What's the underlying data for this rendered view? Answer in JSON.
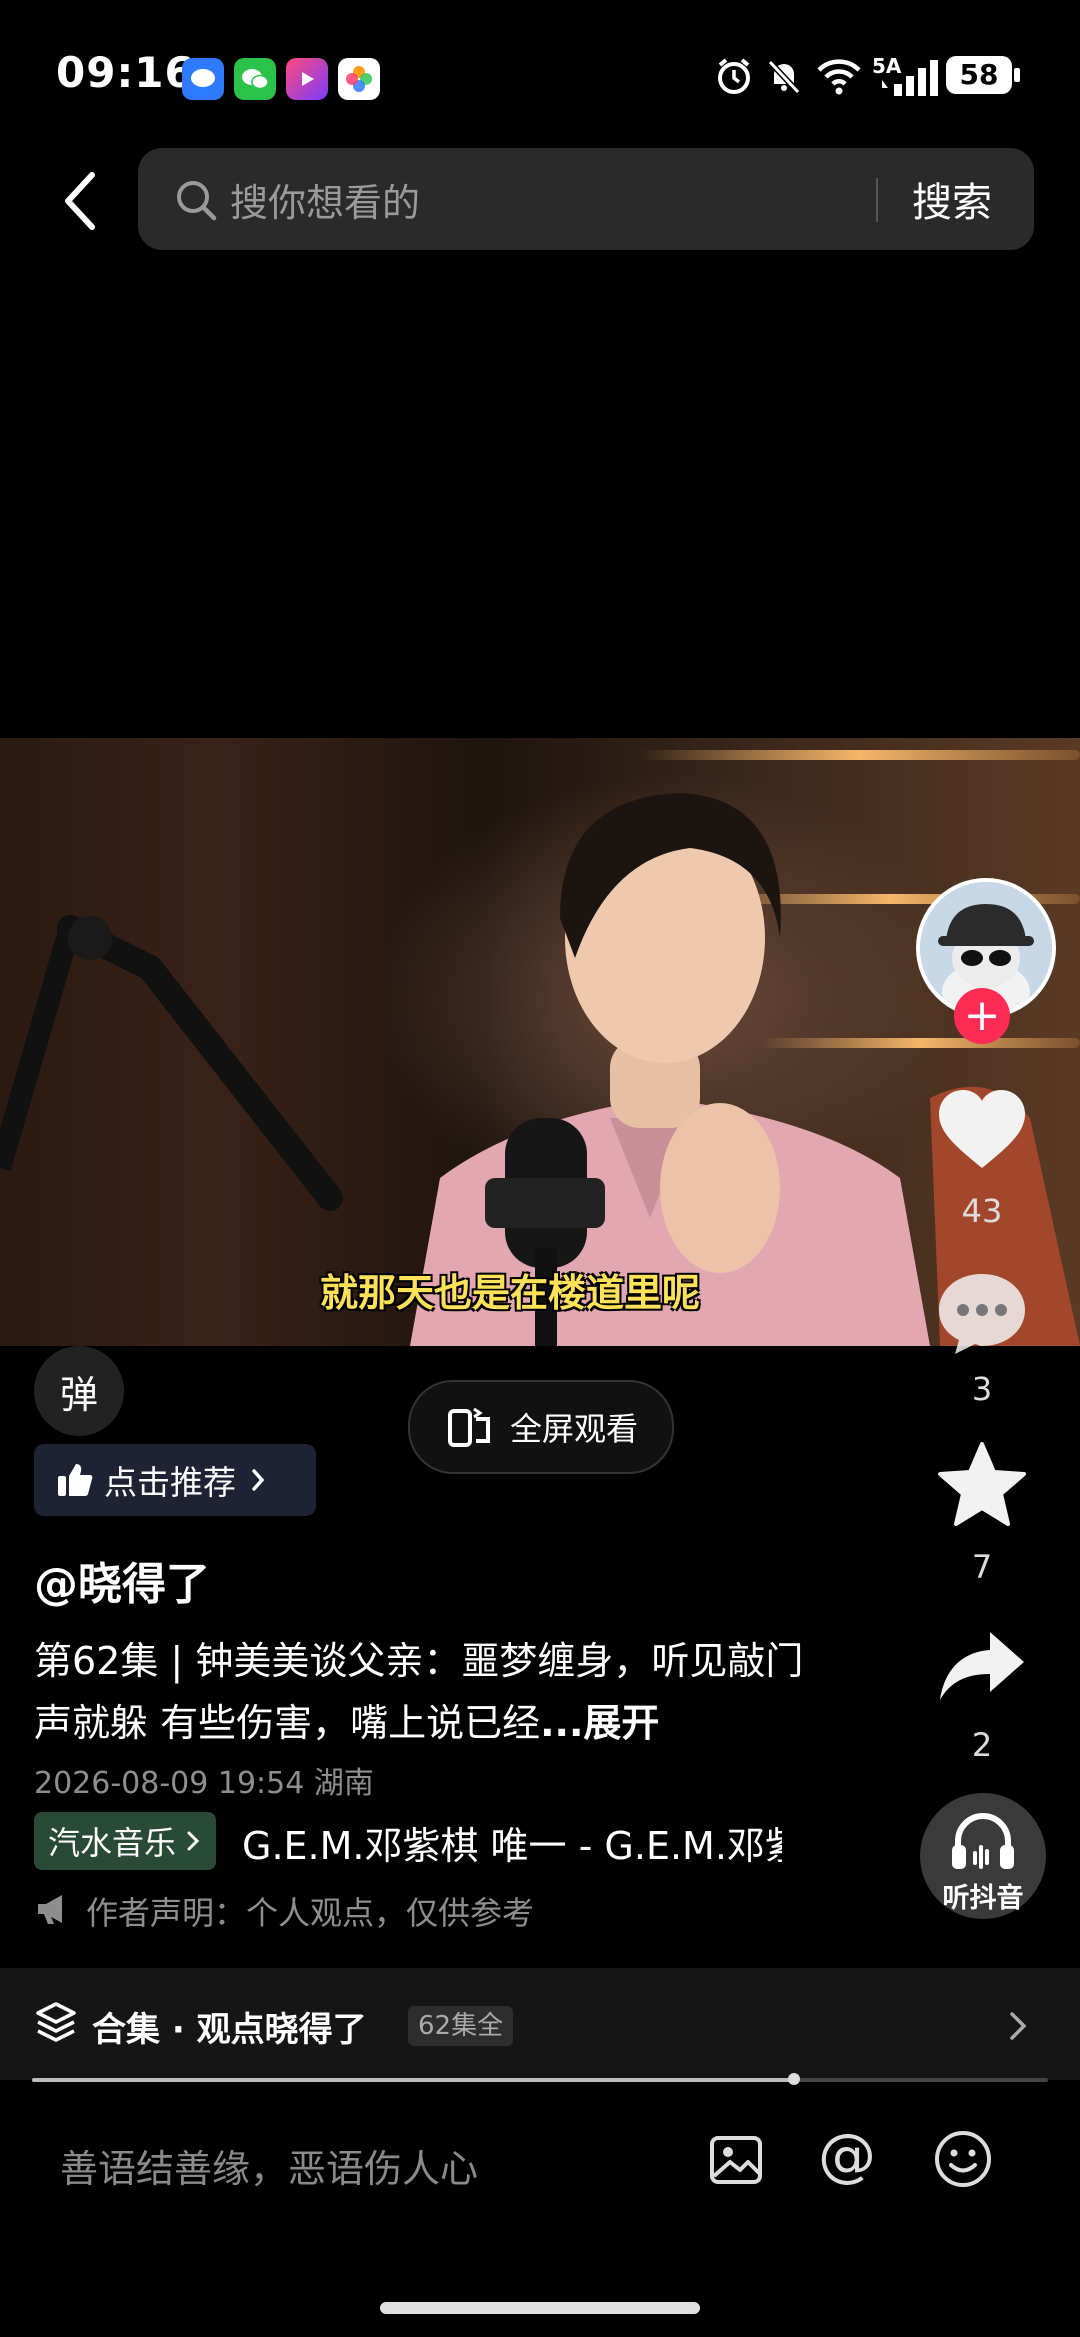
{
  "status_bar": {
    "time": "09:16",
    "app_icons": [
      "message-icon",
      "wechat-icon",
      "video-app-icon",
      "photos-icon"
    ],
    "network_label": "5A",
    "battery": "58"
  },
  "search": {
    "placeholder": "搜你想看的",
    "button_label": "搜索"
  },
  "video": {
    "subtitle": "就那天也是在楼道里呢"
  },
  "actions": {
    "likes": "43",
    "comments": "3",
    "favorites": "7",
    "shares": "2",
    "listen_label": "听抖音"
  },
  "overlay": {
    "danmaku_label": "弹",
    "fullscreen_label": "全屏观看",
    "recommend_label": "点击推荐"
  },
  "post": {
    "author": "@晓得了",
    "title": "第62集 | 钟美美谈父亲：噩梦缠身，听见敲门声就躲 有些伤害，嘴上说已经",
    "expand": "...展开",
    "meta": "2026-08-09 19:54 湖南",
    "music_tag": "汽水音乐",
    "music_title": "G.E.M.邓紫棋  唯一 - G.E.M.邓紫棋",
    "author_statement": "作者声明：个人观点，仅供参考"
  },
  "collection": {
    "title": "合集 · 观点晓得了",
    "badge": "62集全"
  },
  "playback": {
    "progress": 0.75
  },
  "comment": {
    "placeholder": "善语结善缘，恶语伤人心",
    "mention_symbol": "@"
  },
  "colors": {
    "accent": "#fe2c55",
    "subtitle": "#ffe25a",
    "background": "#000000"
  }
}
